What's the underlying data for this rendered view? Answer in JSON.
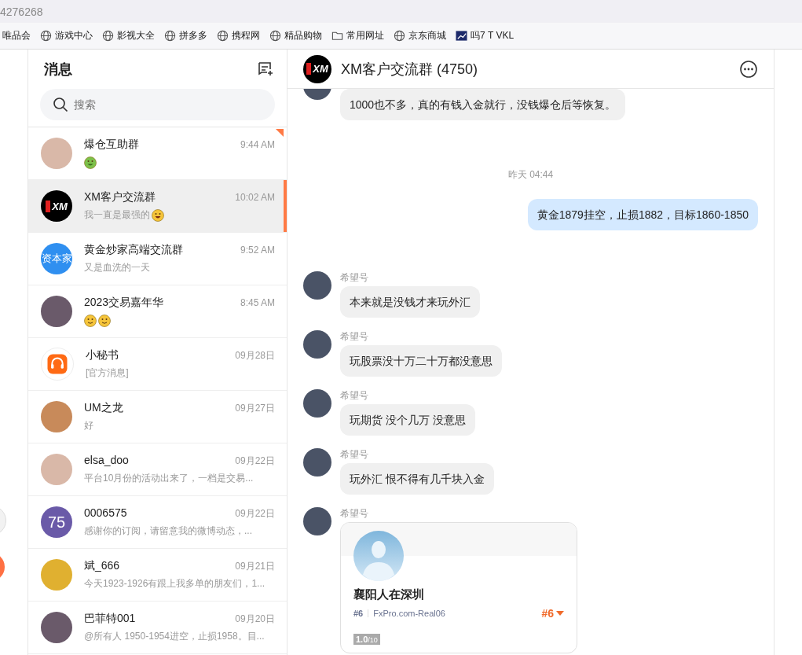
{
  "address_bar": {
    "text": "4276268"
  },
  "bookmarks": [
    {
      "label": "唯品会",
      "kind": "plain"
    },
    {
      "label": "游戏中心",
      "kind": "site"
    },
    {
      "label": "影视大全",
      "kind": "site"
    },
    {
      "label": "拼多多",
      "kind": "site"
    },
    {
      "label": "携程网",
      "kind": "site"
    },
    {
      "label": "精品购物",
      "kind": "site"
    },
    {
      "label": "常用网址",
      "kind": "folder"
    },
    {
      "label": "京东商城",
      "kind": "site"
    },
    {
      "label": "吗7 T VKL",
      "kind": "app"
    }
  ],
  "sidebar": {
    "title": "消息",
    "search": {
      "placeholder": "搜索"
    },
    "conversations": [
      {
        "name": "爆仓互助群",
        "time": "9:44 AM",
        "avatar": {
          "kind": "photo"
        },
        "emojis": [
          {
            "kind": "money"
          }
        ],
        "selected": false,
        "pinned": true
      },
      {
        "name": "XM客户交流群",
        "time": "10:02 AM",
        "avatar": {
          "kind": "logo",
          "text": "XM"
        },
        "preview": "我一直是最强的",
        "emojis": [
          {
            "kind": "laugh"
          }
        ],
        "selected": true,
        "pinned": false
      },
      {
        "name": "黄金炒家高端交流群",
        "time": "9:52 AM",
        "avatar": {
          "kind": "text",
          "text": "资本家"
        },
        "preview": "又是血洗的一天",
        "selected": false,
        "pinned": false
      },
      {
        "name": "2023交易嘉年华",
        "time": "8:45 AM",
        "avatar": {
          "kind": "photo"
        },
        "emojis": [
          {
            "kind": "smile"
          },
          {
            "kind": "smile"
          }
        ],
        "selected": false,
        "pinned": false
      },
      {
        "name": "小秘书",
        "time": "09月28日",
        "avatar": {
          "kind": "headset"
        },
        "preview": "[官方消息]",
        "selected": false,
        "pinned": false
      },
      {
        "name": "UM之龙",
        "time": "09月27日",
        "avatar": {
          "kind": "photo"
        },
        "preview": "好",
        "selected": false,
        "pinned": false
      },
      {
        "name": "elsa_doo",
        "time": "09月22日",
        "avatar": {
          "kind": "photo"
        },
        "preview": "平台10月份的活动出来了，一档是交易...",
        "selected": false,
        "pinned": false
      },
      {
        "name": "0006575",
        "time": "09月22日",
        "avatar": {
          "kind": "text",
          "text": "75"
        },
        "preview": "感谢你的订阅，请留意我的微博动态，...",
        "selected": false,
        "pinned": false
      },
      {
        "name": "斌_666",
        "time": "09月21日",
        "avatar": {
          "kind": "photo"
        },
        "preview": "今天1923-1926有跟上我多单的朋友们，1...",
        "selected": false,
        "pinned": false
      },
      {
        "name": "巴菲特001",
        "time": "09月20日",
        "avatar": {
          "kind": "photo"
        },
        "preview": "@所有人 1950-1954进空，止损1958。目...",
        "selected": false,
        "pinned": false
      }
    ]
  },
  "chat": {
    "title": "XM客户交流群 (4750)",
    "avatar_text": "XM",
    "messages": [
      {
        "kind": "incoming",
        "text": "1000也不多，真的有钱入金就行，没钱爆仓后等恢复。"
      },
      {
        "kind": "timestamp",
        "text": "昨天 04:44"
      },
      {
        "kind": "outgoing",
        "text": "黄金1879挂空，止损1882，目标1860-1850"
      },
      {
        "kind": "incoming",
        "sender": "希望号",
        "text": "本来就是没钱才来玩外汇"
      },
      {
        "kind": "incoming",
        "sender": "希望号",
        "text": "玩股票没十万二十万都没意思"
      },
      {
        "kind": "incoming",
        "sender": "希望号",
        "text": "玩期货 没个几万 没意思"
      },
      {
        "kind": "incoming",
        "sender": "希望号",
        "text": "玩外汇 恨不得有几千块入金"
      },
      {
        "kind": "card",
        "sender": "希望号",
        "name": "襄阳人在深圳",
        "rank": "#6",
        "server": "FxPro.com-Real06",
        "position": "#6",
        "score": "1.0",
        "score_max": "/10"
      }
    ]
  }
}
